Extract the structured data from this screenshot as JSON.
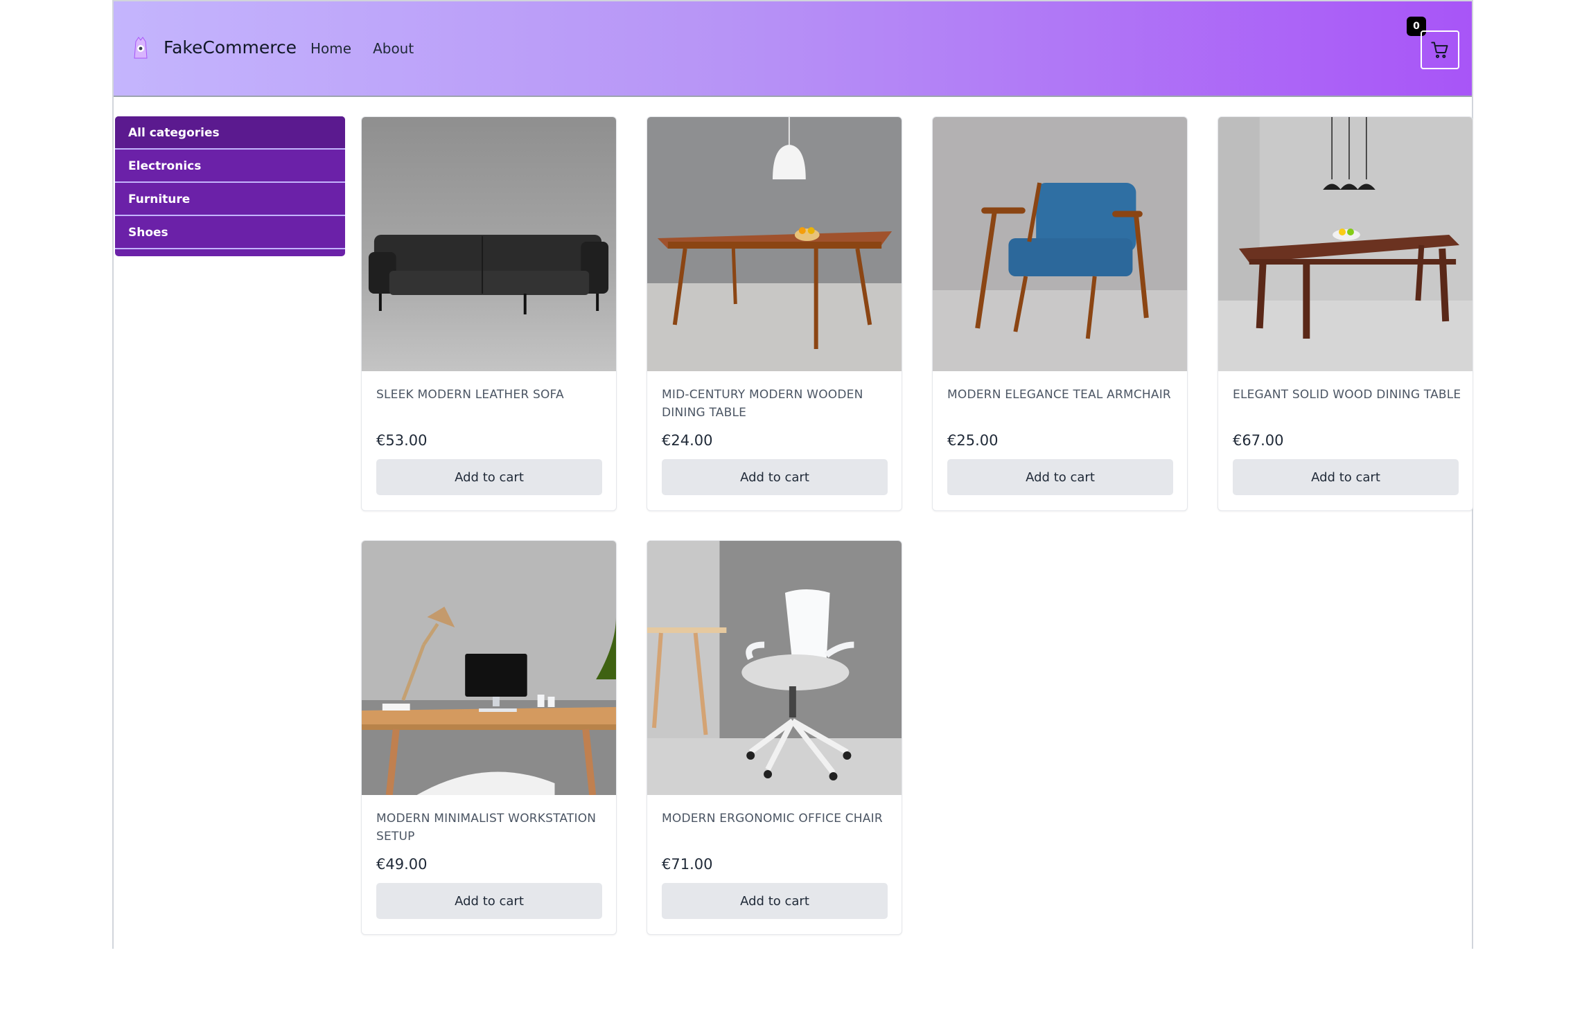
{
  "header": {
    "brand": "FakeCommerce",
    "nav": [
      "Home",
      "About"
    ],
    "cart_count": "0",
    "colors": {
      "gradient_start": "#c4b5fd",
      "gradient_end": "#a855f7"
    }
  },
  "sidebar": {
    "items": [
      {
        "label": "All categories",
        "active": true
      },
      {
        "label": "Electronics"
      },
      {
        "label": "Furniture"
      },
      {
        "label": "Shoes"
      }
    ]
  },
  "products": [
    {
      "title": "SLEEK MODERN LEATHER SOFA",
      "price": "€53.00",
      "button": "Add to cart",
      "image": "sofa"
    },
    {
      "title": "MID-CENTURY MODERN WOODEN DINING TABLE",
      "price": "€24.00",
      "button": "Add to cart",
      "image": "table-lamp"
    },
    {
      "title": "MODERN ELEGANCE TEAL ARMCHAIR",
      "price": "€25.00",
      "button": "Add to cart",
      "image": "armchair"
    },
    {
      "title": "ELEGANT SOLID WOOD DINING TABLE",
      "price": "€67.00",
      "button": "Add to cart",
      "image": "dining-table"
    },
    {
      "title": "MODERN MINIMALIST WORKSTATION SETUP",
      "price": "€49.00",
      "button": "Add to cart",
      "image": "workstation"
    },
    {
      "title": "MODERN ERGONOMIC OFFICE CHAIR",
      "price": "€71.00",
      "button": "Add to cart",
      "image": "office-chair"
    }
  ]
}
